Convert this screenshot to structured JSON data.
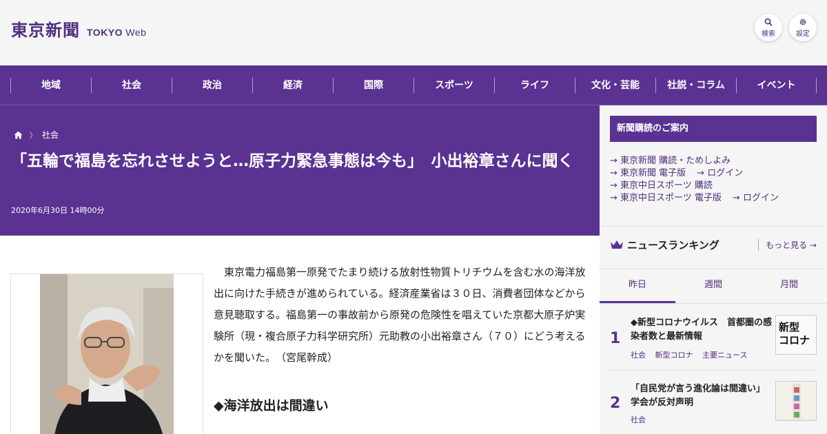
{
  "header": {
    "logo_jp": "東京新聞",
    "logo_en_bold": "TOKYO",
    "logo_en_light": "Web",
    "search_label": "検索",
    "settings_label": "設定"
  },
  "nav": {
    "items": [
      "地域",
      "社会",
      "政治",
      "経済",
      "国際",
      "スポーツ",
      "ライフ",
      "文化・芸能",
      "社説・コラム",
      "イベント"
    ]
  },
  "article": {
    "breadcrumb": "社会",
    "title": "「五輪で福島を忘れさせようと…原子力緊急事態は今も」　小出裕章さんに聞く",
    "date": "2020年6月30日 14時00分",
    "lead": "東京電力福島第一原発でたまり続ける放射性物質トリチウムを含む水の海洋放出に向けた手続きが進められている。経済産業省は３０日、消費者団体などから意見聴取する。福島第一の事故前から原発の危険性を唱えていた京都大原子炉実験所（現・複合原子力科学研究所）元助教の小出裕章さん（７０）にどう考えるかを聞いた。　（宮尾幹成）",
    "subhead": "◆海洋放出は間違い"
  },
  "sidebar": {
    "subscribe_title": "新聞購読のご案内",
    "links": {
      "l1": "東京新聞 購読・ためしよみ",
      "l2": "東京新聞 電子版",
      "l2b": "ログイン",
      "l3": "東京中日スポーツ 購読",
      "l4": "東京中日スポーツ 電子版",
      "l4b": "ログイン"
    },
    "ranking_title": "ニュースランキング",
    "ranking_more": "もっと見る",
    "tabs": [
      "昨日",
      "週間",
      "月間"
    ],
    "items": [
      {
        "rank": "1",
        "text": "◆新型コロナウイルス　首都圏の感染者数と最新情報",
        "tags": [
          "社会",
          "新型コロナ",
          "主要ニュース"
        ],
        "thumb_line1": "新型",
        "thumb_line2": "コロナ"
      },
      {
        "rank": "2",
        "text": "「自民党が言う進化論は間違い」　学会が反対声明",
        "tags": [
          "社会"
        ]
      }
    ]
  },
  "colors": {
    "brand_purple": "#5a3292",
    "link_purple": "#4f2d7f"
  }
}
